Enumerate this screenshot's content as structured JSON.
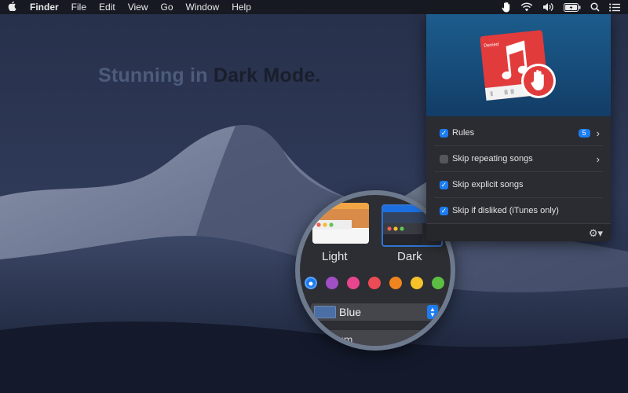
{
  "menubar": {
    "app_name": "Finder",
    "items": [
      "File",
      "Edit",
      "View",
      "Go",
      "Window",
      "Help"
    ]
  },
  "headline": {
    "part1": "Stunning in ",
    "part2": "Dark Mode."
  },
  "popover": {
    "album_text": "Denied",
    "rows": [
      {
        "label": "Rules",
        "checked": true,
        "badge": "5",
        "chevron": true
      },
      {
        "label": "Skip repeating songs",
        "checked": false,
        "chevron": true
      },
      {
        "label": "Skip explicit songs",
        "checked": true
      },
      {
        "label": "Skip if disliked (iTunes only)",
        "checked": true
      }
    ]
  },
  "magnifier": {
    "light_label": "Light",
    "dark_label": "Dark",
    "accent_colors": [
      "#1c7cf0",
      "#a04fc4",
      "#e8458f",
      "#ec4b55",
      "#f0851f",
      "#f5c22a",
      "#5cbf43"
    ],
    "select_value": "Blue",
    "next_field_partial": "um"
  },
  "colors": {
    "accent": "#1c7cf0",
    "brand_red": "#e23b3b"
  }
}
